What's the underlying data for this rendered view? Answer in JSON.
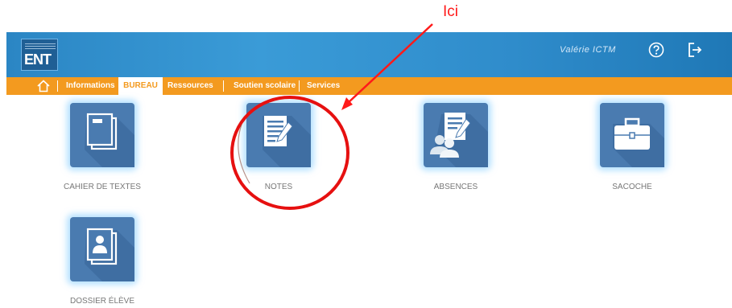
{
  "annotation": {
    "text": "Ici",
    "color": "#ff1a1a"
  },
  "header": {
    "logo_text": "ENT",
    "user_name": "Valérie ICTM",
    "help_icon": "help-icon",
    "logout_icon": "logout-icon",
    "color": "#2f8ccb"
  },
  "nav": {
    "color": "#f39a1f",
    "home_icon": "home-icon",
    "items": [
      {
        "label": "Informations"
      },
      {
        "label": "BUREAU",
        "active": true
      },
      {
        "label": "Ressources"
      },
      {
        "label": "Soutien scolaire"
      },
      {
        "label": "Services"
      }
    ]
  },
  "tiles": [
    {
      "label": "CAHIER DE TEXTES",
      "icon": "notebook-icon"
    },
    {
      "label": "NOTES",
      "icon": "notes-icon"
    },
    {
      "label": "ABSENCES",
      "icon": "absences-icon"
    },
    {
      "label": "SACOCHE",
      "icon": "briefcase-icon"
    },
    {
      "label": "DOSSIER ÉLÈVE",
      "icon": "student-file-icon"
    }
  ]
}
